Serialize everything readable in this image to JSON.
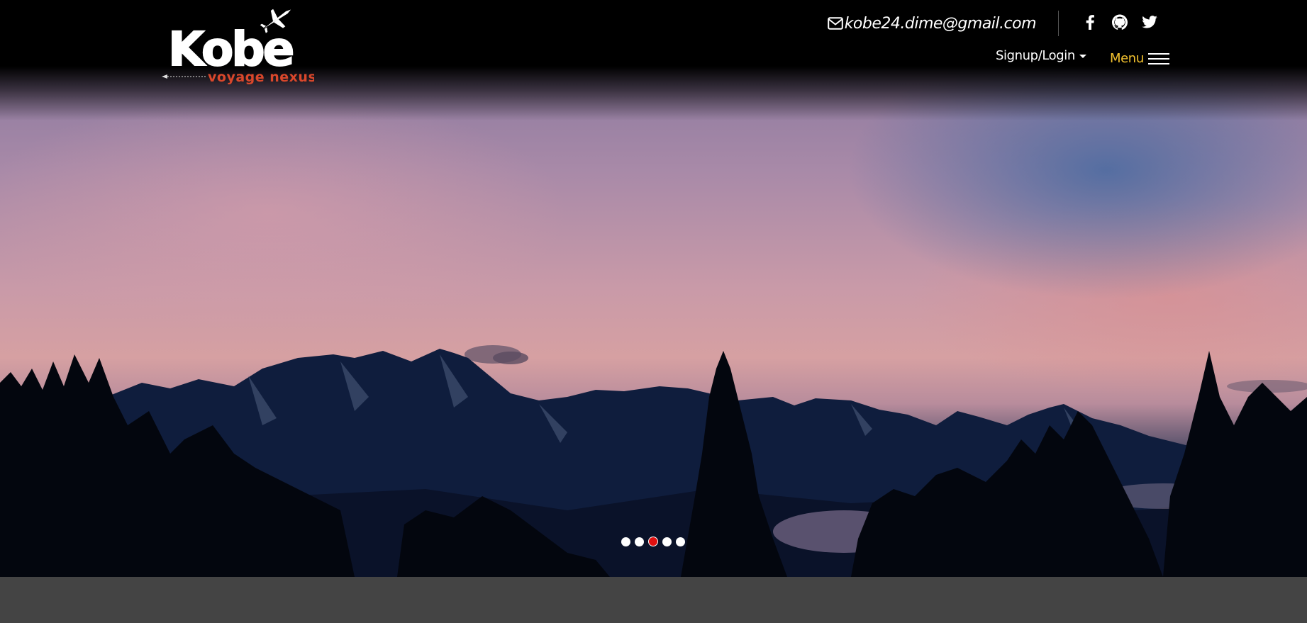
{
  "brand": {
    "name": "Kobe",
    "tagline": "voyage nexus",
    "tagline_color": "#d9472b"
  },
  "header": {
    "email": "kobe24.dime@gmail.com",
    "email_icon": "envelope-icon",
    "social": [
      {
        "name": "facebook-icon"
      },
      {
        "name": "github-icon"
      },
      {
        "name": "twitter-icon"
      }
    ],
    "signup_label": "Signup/Login",
    "menu_label": "Menu",
    "menu_color": "#f2c12e"
  },
  "carousel": {
    "slide_count": 5,
    "active_index": 2,
    "active_color": "#e01010"
  }
}
